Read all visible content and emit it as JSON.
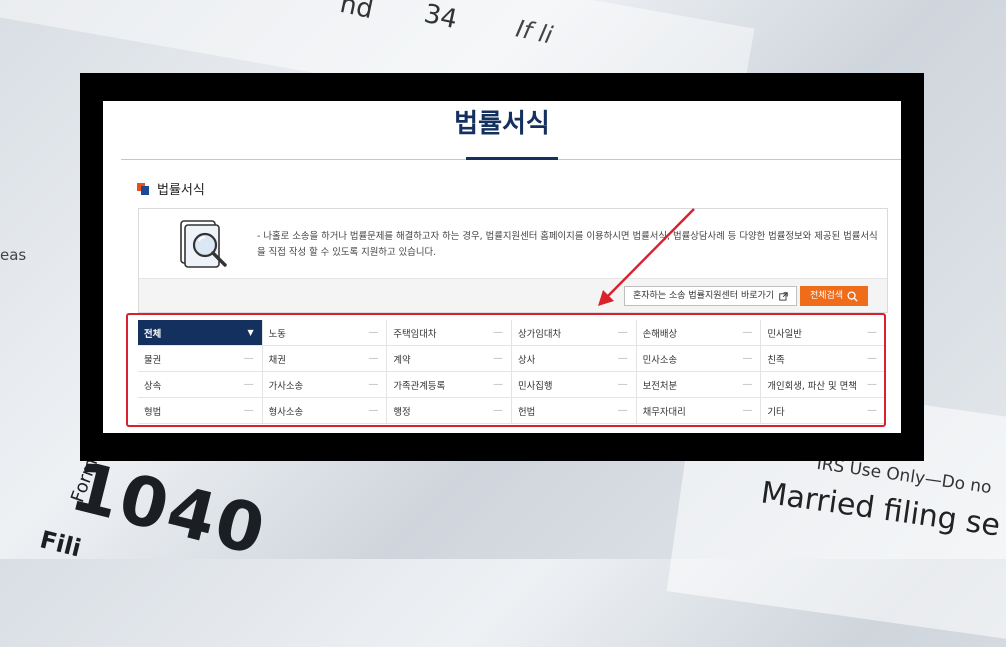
{
  "page": {
    "title": "법률서식",
    "section_title": "법률서식",
    "description": "- 나홀로 소송을 하거나 법률문제를 해결하고자 하는 경우, 법률지원센터 홈페이지를 이용하시면 법률서식, 법률상담사례 등 다양한 법률정보와 제공된 법률서식을 직접 작성 할 수 있도록 지원하고 있습니다."
  },
  "actions": {
    "link_label": "혼자하는 소송 법률지원센터 바로가기",
    "search_label": "전체검색"
  },
  "categories": [
    {
      "label": "전체",
      "active": true
    },
    {
      "label": "노동"
    },
    {
      "label": "주택임대차"
    },
    {
      "label": "상가임대차"
    },
    {
      "label": "손해배상"
    },
    {
      "label": "민사일반"
    },
    {
      "label": "물권"
    },
    {
      "label": "채권"
    },
    {
      "label": "계약"
    },
    {
      "label": "상사"
    },
    {
      "label": "민사소송"
    },
    {
      "label": "친족"
    },
    {
      "label": "상속"
    },
    {
      "label": "가사소송"
    },
    {
      "label": "가족관계등록"
    },
    {
      "label": "민사집행"
    },
    {
      "label": "보전처분"
    },
    {
      "label": "개인회생, 파산 및 면책"
    },
    {
      "label": "형법"
    },
    {
      "label": "형사소송"
    },
    {
      "label": "행정"
    },
    {
      "label": "헌법"
    },
    {
      "label": "채무자대리"
    },
    {
      "label": "기타"
    }
  ],
  "background": {
    "form_number": "1040",
    "form_label": "Form",
    "filing_text": "Fili",
    "irs_text": "IRS Use Only—Do no",
    "married_text": "Married filing se",
    "top_text": "nd",
    "top_number": "34",
    "top_if": "If li",
    "left_text": "eas"
  },
  "colors": {
    "navy": "#14305e",
    "orange": "#ef6c1a",
    "highlight_red": "#d9202c"
  }
}
